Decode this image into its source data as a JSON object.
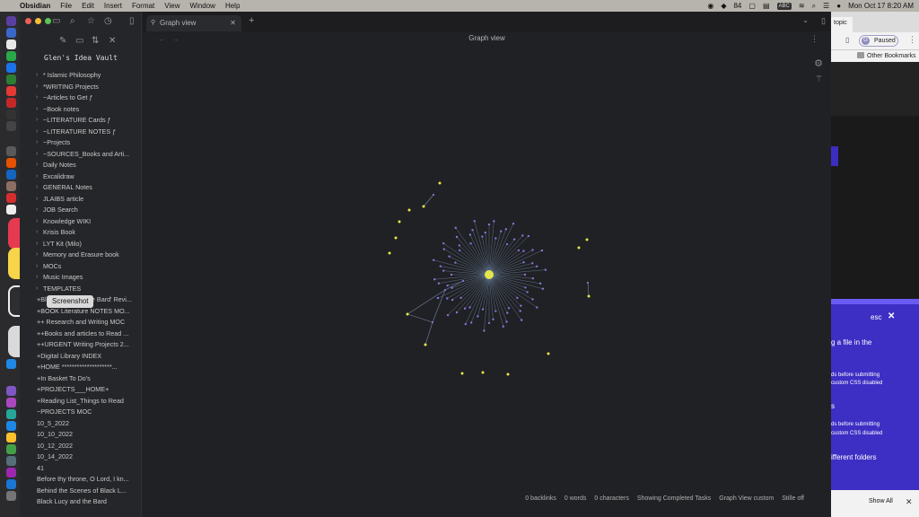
{
  "menubar": {
    "app": "Obsidian",
    "items": [
      "File",
      "Edit",
      "Insert",
      "Format",
      "View",
      "Window",
      "Help"
    ],
    "badge": "84",
    "input_source": "ABC",
    "datetime": "Mon Oct 17  8:20 AM"
  },
  "tooltip": "Screenshot",
  "sidebar": {
    "vault_name": "Glen's Idea Vault",
    "items": [
      {
        "label": "* Islamic Philosophy",
        "folder": true
      },
      {
        "label": "*WRITING Projects",
        "folder": true
      },
      {
        "label": "~Articles to Get ƒ",
        "folder": true
      },
      {
        "label": "~Book notes",
        "folder": true
      },
      {
        "label": "~LITERATURE Cards ƒ",
        "folder": true
      },
      {
        "label": "~LITERATURE NOTES ƒ",
        "folder": true
      },
      {
        "label": "~Projects",
        "folder": true
      },
      {
        "label": "~SOURCES_Books and Arti...",
        "folder": true
      },
      {
        "label": "Daily Notes",
        "folder": true
      },
      {
        "label": "Excalidraw",
        "folder": true
      },
      {
        "label": "GENERAL Notes",
        "folder": true
      },
      {
        "label": "JLAIBS article",
        "folder": true
      },
      {
        "label": "JOB Search",
        "folder": true
      },
      {
        "label": "Knowledge WIKI",
        "folder": true
      },
      {
        "label": "Krisis Book",
        "folder": true
      },
      {
        "label": "LYT Kit (Milo)",
        "folder": true
      },
      {
        "label": "Memory and Erasure book",
        "folder": true
      },
      {
        "label": "MOCs",
        "folder": true
      },
      {
        "label": "Music Images",
        "folder": true
      },
      {
        "label": "TEMPLATES",
        "folder": true
      },
      {
        "label": "+Black Lucy and the Bard' Revi...",
        "folder": false
      },
      {
        "label": "+BOOK Literature NOTES MO...",
        "folder": false
      },
      {
        "label": "++ Research and Writing MOC",
        "folder": false
      },
      {
        "label": "++Books and articles to Read ...",
        "folder": false
      },
      {
        "label": "++URGENT Writing Projects 2...",
        "folder": false
      },
      {
        "label": "+Digital Library INDEX",
        "folder": false
      },
      {
        "label": "+HOME ********************...",
        "folder": false
      },
      {
        "label": "+In Basket To Do's",
        "folder": false
      },
      {
        "label": "+PROJECTS___HOME+",
        "folder": false
      },
      {
        "label": "+Reading List_Things to Read",
        "folder": false
      },
      {
        "label": "~PROJECTS MOC",
        "folder": false
      },
      {
        "label": "10_5_2022",
        "folder": false
      },
      {
        "label": "10_10_2022",
        "folder": false
      },
      {
        "label": "10_12_2022",
        "folder": false
      },
      {
        "label": "10_14_2022",
        "folder": false
      },
      {
        "label": "41",
        "folder": false
      },
      {
        "label": "Before thy throne, O Lord, I kn...",
        "folder": false
      },
      {
        "label": "Behind the Scenes of Black L...",
        "folder": false
      },
      {
        "label": "Black Lucy and the Bard",
        "folder": false
      }
    ]
  },
  "tab": {
    "title": "Graph view"
  },
  "view": {
    "title": "Graph view"
  },
  "status_bar": [
    "0 backlinks",
    "0 words",
    "0 characters",
    "Showing Completed Tasks",
    "Graph View custom",
    "Stille off"
  ],
  "graph": {
    "node_color": "#e6e64a",
    "leaf_color": "#8a74e0",
    "edge_color": "#6f86a6",
    "hub_leaf_count": 72,
    "orphans": 14
  },
  "right_browser": {
    "tab_text": "topic",
    "paused_label": "Paused",
    "profile_letter": "G",
    "bookmarks": "Other Bookmarks",
    "esc": "esc",
    "line1": "g a file in the",
    "line2": "ds before submitting",
    "line3": "custom CSS disabled",
    "line4": "s",
    "line5": "ds before submitting",
    "line6": "custom CSS disabled",
    "line7": "ifferent folders",
    "show_all": "Show All"
  },
  "colors": {
    "accent": "#7b6cf6",
    "background": "#202124",
    "sidebar": "#252629"
  }
}
